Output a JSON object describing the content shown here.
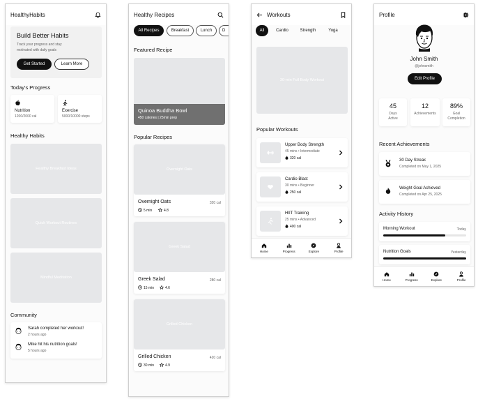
{
  "screen1": {
    "title": "HealthyHabits",
    "hero": {
      "title": "Build Better Habits",
      "subtitle_line1": "Track your progress and stay",
      "subtitle_line2": "motivated with daily goals",
      "primary": "Get Started",
      "secondary": "Learn More"
    },
    "progress_title": "Today's Progress",
    "nutrition": {
      "label": "Nutrition",
      "value": "1200/2000 cal"
    },
    "exercise": {
      "label": "Exercise",
      "value": "5000/10000 steps"
    },
    "habits_title": "Healthy Habits",
    "habits": [
      "Healthy Breakfast Ideas",
      "Quick Workout Routines",
      "Mindful Meditation"
    ],
    "community_title": "Community",
    "posts": [
      {
        "text": "Sarah completed her workout!",
        "time": "2 hours ago"
      },
      {
        "text": "Mike hit his nutrition goals!",
        "time": "5 hours ago"
      }
    ]
  },
  "screen2": {
    "title": "Healthy Recipes",
    "chips": [
      "All Recipes",
      "Breakfast",
      "Lunch",
      "D"
    ],
    "featured_title": "Featured Recipe",
    "featured": {
      "name": "Quinoa Buddha Bowl",
      "meta": "450 calories | 25min prep"
    },
    "popular_title": "Popular Recipes",
    "recipes": [
      {
        "image": "Overnight Oats",
        "name": "Overnight Oats",
        "cal": "320 cal",
        "time": "5 min",
        "rating": "4.8"
      },
      {
        "image": "Greek Salad",
        "name": "Greek Salad",
        "cal": "280 cal",
        "time": "15 min",
        "rating": "4.6"
      },
      {
        "image": "Grilled Chicken",
        "name": "Grilled Chicken",
        "cal": "420 cal",
        "time": "30 min",
        "rating": "4.9"
      }
    ]
  },
  "screen3": {
    "title": "Workouts",
    "chips": [
      "All",
      "Cardio",
      "Strength",
      "Yoga"
    ],
    "hero_image": "30-min Full Body Workout",
    "popular_title": "Popular Workouts",
    "workouts": [
      {
        "name": "Upper Body Strength",
        "meta": "45 mins • Intermediate",
        "cal": "320 cal"
      },
      {
        "name": "Cardio Blast",
        "meta": "30 mins • Beginner",
        "cal": "250 cal"
      },
      {
        "name": "HIIT Training",
        "meta": "25 mins • Advanced",
        "cal": "400 cal"
      }
    ]
  },
  "screen4": {
    "title": "Profile",
    "name": "John Smith",
    "handle": "@johnsmith",
    "edit": "Edit Profile",
    "stats": [
      {
        "value": "45",
        "label1": "Days",
        "label2": "Active"
      },
      {
        "value": "12",
        "label1": "Achievements",
        "label2": ""
      },
      {
        "value": "89%",
        "label1": "Goal",
        "label2": "Completion"
      }
    ],
    "achievements_title": "Recent Achievements",
    "achievements": [
      {
        "name": "30 Day Streak",
        "date": "Completed on May 1, 2025"
      },
      {
        "name": "Weight Goal Achieved",
        "date": "Completed on Apr 25, 2025"
      }
    ],
    "activity_title": "Activity History",
    "activity": [
      {
        "name": "Morning Workout",
        "when": "Today",
        "progress": 0.75
      },
      {
        "name": "Nutrition Goals",
        "when": "Yesterday",
        "progress": 1.0
      }
    ]
  },
  "nav": [
    "Home",
    "Progress",
    "Explore",
    "Profile"
  ]
}
